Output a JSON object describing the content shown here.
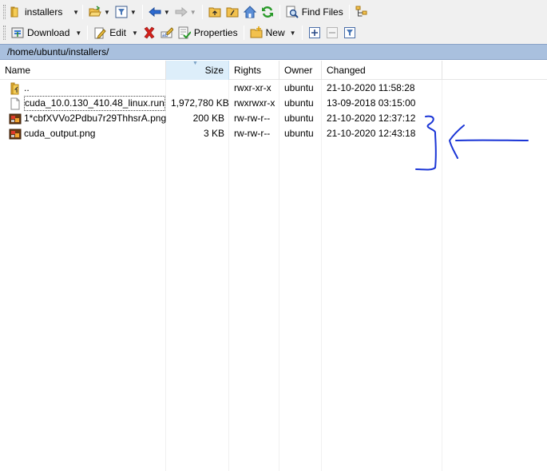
{
  "toolbar": {
    "path_combo": "installers",
    "find_files": "Find Files",
    "download": "Download",
    "edit": "Edit",
    "properties": "Properties",
    "new": "New"
  },
  "address": "/home/ubuntu/installers/",
  "columns": [
    "Name",
    "Size",
    "Rights",
    "Owner",
    "Changed"
  ],
  "sorted_column": "Size",
  "files": [
    {
      "name": "..",
      "size": "",
      "rights": "rwxr-xr-x",
      "owner": "ubuntu",
      "changed": "21-10-2020 11:58:28",
      "icon": "parent-folder-icon"
    },
    {
      "name": "cuda_10.0.130_410.48_linux.run",
      "size": "1,972,780 KB",
      "rights": "rwxrwxr-x",
      "owner": "ubuntu",
      "changed": "13-09-2018 03:15:00",
      "icon": "file-icon"
    },
    {
      "name": "1*cbfXVVo2Pdbu7r29ThhsrA.png",
      "size": "200 KB",
      "rights": "rw-rw-r--",
      "owner": "ubuntu",
      "changed": "21-10-2020 12:37:12",
      "icon": "image-file-icon"
    },
    {
      "name": "cuda_output.png",
      "size": "3 KB",
      "rights": "rw-rw-r--",
      "owner": "ubuntu",
      "changed": "21-10-2020 12:43:18",
      "icon": "image-file-icon"
    }
  ],
  "colors": {
    "address_bar": "#a9c0de",
    "toolbar_bg": "#f0f0f0",
    "sorted_header": "#ddeefa",
    "annotation_ink": "#1a35d6"
  }
}
